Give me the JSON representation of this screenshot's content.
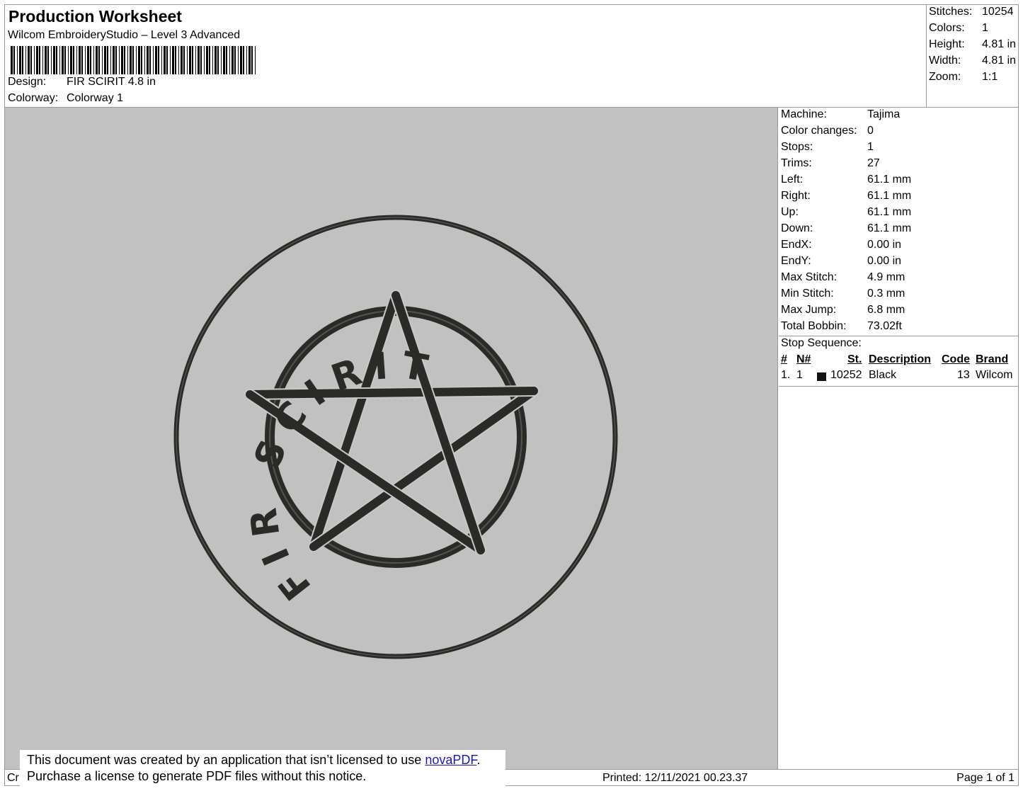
{
  "header": {
    "title": "Production Worksheet",
    "software": "Wilcom EmbroideryStudio – Level 3 Advanced",
    "design_label": "Design:",
    "design_value": "FIR SCIRIT 4.8 in",
    "colorway_label": "Colorway:",
    "colorway_value": "Colorway 1"
  },
  "summary": [
    {
      "label": "Stitches:",
      "value": "10254"
    },
    {
      "label": "Colors:",
      "value": "1"
    },
    {
      "label": "Height:",
      "value": "4.81 in"
    },
    {
      "label": "Width:",
      "value": "4.81 in"
    },
    {
      "label": "Zoom:",
      "value": "1:1"
    }
  ],
  "machine_info": [
    {
      "label": "Machine:",
      "value": "Tajima"
    },
    {
      "label": "Color changes:",
      "value": "0"
    },
    {
      "label": "Stops:",
      "value": "1"
    },
    {
      "label": "Trims:",
      "value": "27"
    },
    {
      "label": "Left:",
      "value": "61.1 mm"
    },
    {
      "label": "Right:",
      "value": "61.1 mm"
    },
    {
      "label": "Up:",
      "value": "61.1 mm"
    },
    {
      "label": "Down:",
      "value": "61.1 mm"
    },
    {
      "label": "EndX:",
      "value": "0.00 in"
    },
    {
      "label": "EndY:",
      "value": "0.00 in"
    },
    {
      "label": "Max Stitch:",
      "value": "4.9 mm"
    },
    {
      "label": "Min Stitch:",
      "value": "0.3 mm"
    },
    {
      "label": "Max Jump:",
      "value": "6.8 mm"
    },
    {
      "label": "Total Bobbin:",
      "value": "73.02ft"
    }
  ],
  "stop_sequence": {
    "title": "Stop Sequence:",
    "columns": {
      "num": "#",
      "n": "N#",
      "st": "St.",
      "description": "Description",
      "code": "Code",
      "brand": "Brand"
    },
    "rows": [
      {
        "num": "1.",
        "n": "1",
        "st": "10252",
        "description": "Black",
        "code": "13",
        "brand": "Wilcom",
        "color": "#111111"
      }
    ]
  },
  "design": {
    "thread_color": "#2b2a27",
    "background": "#c1c1c1",
    "ring_text": "FIR SCIRIT"
  },
  "footer": {
    "created_prefix": "Cr",
    "printed": "Printed:  12/11/2021 00.23.37",
    "page": "Page 1 of 1"
  },
  "notice": {
    "line1_text": "This document was created by an application that isn’t licensed to use ",
    "link": "novaPDF",
    "line1_end": ".",
    "line2": "Purchase a license to generate PDF files without this notice."
  }
}
